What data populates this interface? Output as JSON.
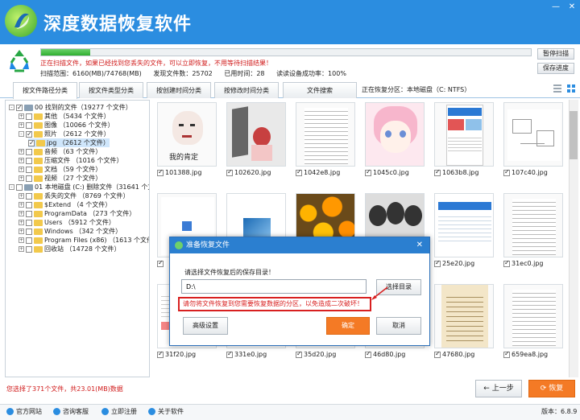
{
  "app": {
    "title": "深度数据恢复软件",
    "version": "版本：6.8.9"
  },
  "window": {
    "minimize_icon": "minimize-icon",
    "close_icon": "close-icon"
  },
  "scan": {
    "progress": 0.1,
    "warning": "正在扫描文件，如果已经找到您丢失的文件，可以立即恢复，不用等待扫描结果！",
    "range_label": "扫描范围：6160(MB)/74768(MB)",
    "found_label": "发现文件数：25702",
    "elapsed_label": "已用时间：28",
    "read_label": "读读设备成功率：100%",
    "pause_label": "暂停扫描",
    "save_label": "保存进度"
  },
  "tabs": [
    "按文件路径分类",
    "按文件类型分类",
    "按创建时间分类",
    "按修改时间分类",
    "文件搜索"
  ],
  "partition_label": "正在恢复分区：本地磁盘（C: NTFS）",
  "tree": [
    {
      "label": "00 找到的文件（19277 个文件）",
      "indent": 0,
      "pm": "-",
      "kind": "disk",
      "checked": true
    },
    {
      "label": "其他   （5434 个文件）",
      "indent": 1,
      "pm": "+",
      "kind": "folder"
    },
    {
      "label": "图像   （10066 个文件）",
      "indent": 1,
      "pm": "+",
      "kind": "folder"
    },
    {
      "label": "照片   （2612 个文件）",
      "indent": 1,
      "pm": "-",
      "kind": "folder",
      "checked": true
    },
    {
      "label": "jpg   （2612 个文件）",
      "indent": 2,
      "pm": "",
      "kind": "folder",
      "checked": true,
      "selected": true
    },
    {
      "label": "音频   （63 个文件）",
      "indent": 1,
      "pm": "+",
      "kind": "folder"
    },
    {
      "label": "压缩文件   （1016 个文件）",
      "indent": 1,
      "pm": "+",
      "kind": "folder"
    },
    {
      "label": "文档   （59 个文件）",
      "indent": 1,
      "pm": "+",
      "kind": "folder"
    },
    {
      "label": "视频   （27 个文件）",
      "indent": 1,
      "pm": "+",
      "kind": "folder"
    },
    {
      "label": "01 本地磁盘 (C:) 删除文件（31641 个文",
      "indent": 0,
      "pm": "-",
      "kind": "disk"
    },
    {
      "label": "丢失的文件   （8769 个文件）",
      "indent": 1,
      "pm": "+",
      "kind": "folder"
    },
    {
      "label": "$Extend   （4 个文件）",
      "indent": 1,
      "pm": "+",
      "kind": "folder"
    },
    {
      "label": "ProgramData   （273 个文件）",
      "indent": 1,
      "pm": "+",
      "kind": "folder"
    },
    {
      "label": "Users   （5912 个文件）",
      "indent": 1,
      "pm": "+",
      "kind": "folder"
    },
    {
      "label": "Windows   （342 个文件）",
      "indent": 1,
      "pm": "+",
      "kind": "folder"
    },
    {
      "label": "Program Files (x86)   （1613 个文件）",
      "indent": 1,
      "pm": "+",
      "kind": "folder"
    },
    {
      "label": "回收站   （14728 个文件）",
      "indent": 1,
      "pm": "+",
      "kind": "folder"
    }
  ],
  "files": [
    {
      "name": "101388.jpg",
      "thumb": "meme",
      "caption": "我的肯定"
    },
    {
      "name": "102620.jpg",
      "thumb": "anime-red"
    },
    {
      "name": "1042e8.jpg",
      "thumb": "doc"
    },
    {
      "name": "1045c0.jpg",
      "thumb": "anime-pink"
    },
    {
      "name": "1063b8.jpg",
      "thumb": "web"
    },
    {
      "name": "107c40.jpg",
      "thumb": "diagram"
    },
    {
      "name": "",
      "thumb": "qr"
    },
    {
      "name": "",
      "thumb": "blue"
    },
    {
      "name": "",
      "thumb": "flowers"
    },
    {
      "name": "",
      "thumb": "meme-group"
    },
    {
      "name": "25e20.jpg",
      "thumb": "web-blue"
    },
    {
      "name": "31ec0.jpg",
      "thumb": "doc"
    },
    {
      "name": "31f20.jpg",
      "thumb": "web-red"
    },
    {
      "name": "331e0.jpg",
      "thumb": "blank"
    },
    {
      "name": "35d20.jpg",
      "thumb": "doc-green"
    },
    {
      "name": "46d80.jpg",
      "thumb": "doc-small"
    },
    {
      "name": "47680.jpg",
      "thumb": "paper"
    },
    {
      "name": "659ea8.jpg",
      "thumb": "doc"
    }
  ],
  "selection_status": "您选择了371个文件，共23.01(MB)数据",
  "buttons": {
    "prev": "上一步",
    "recover": "恢复"
  },
  "footer": [
    "官方网站",
    "咨询客服",
    "立即注册",
    "关于软件"
  ],
  "dialog": {
    "title": "准备恢复文件",
    "prompt": "请选择文件恢复后的保存目录！",
    "path": "D:\\",
    "choose": "选择目录",
    "hint": "请勿将文件恢复到您需要恢复数据的分区，以免造成二次破坏！",
    "advanced": "高级设置",
    "ok": "确定",
    "cancel": "取消"
  }
}
